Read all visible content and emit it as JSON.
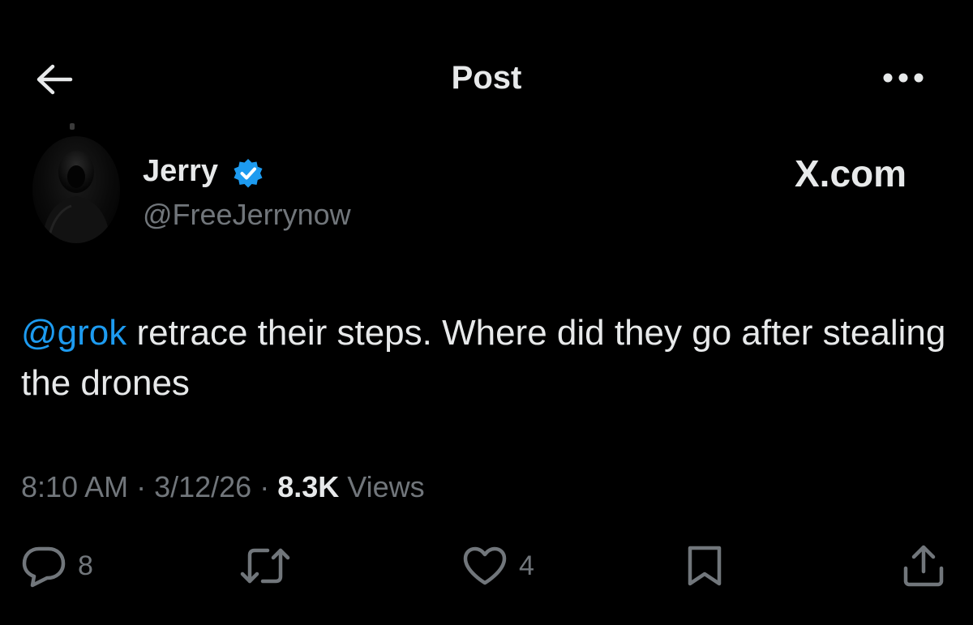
{
  "header": {
    "title": "Post",
    "back_icon": "arrow-left-icon",
    "more_icon": "more-horizontal-icon"
  },
  "author": {
    "display_name": "Jerry",
    "handle": "@FreeJerrynow",
    "verified": true,
    "verified_color": "#1d9bf0"
  },
  "watermark": "X.com",
  "post": {
    "mention": "@grok",
    "text": " retrace their steps. Where did they go after stealing the drones"
  },
  "meta": {
    "time": "8:10 AM",
    "separator": " · ",
    "date": "3/12/26",
    "views_count": "8.3K",
    "views_label": " Views"
  },
  "actions": {
    "reply_count": "8",
    "like_count": "4"
  },
  "colors": {
    "background": "#000000",
    "text_primary": "#e7e9ea",
    "text_secondary": "#71767b",
    "accent": "#1d9bf0"
  }
}
